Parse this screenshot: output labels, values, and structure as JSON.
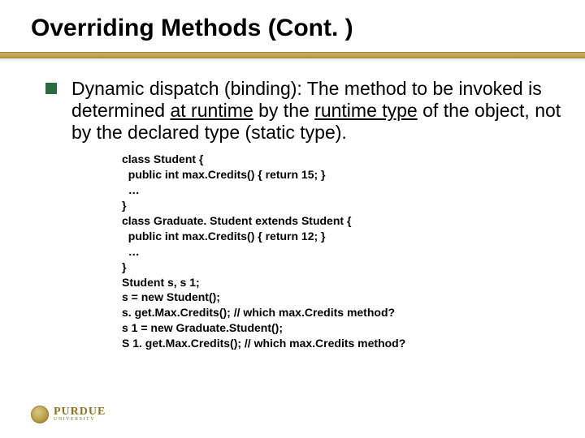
{
  "title": "Overriding Methods (Cont. )",
  "bullet": {
    "seg0": "Dynamic dispatch (binding): The method to be invoked is determined ",
    "seg1": "at runtime",
    "seg2": " by the ",
    "seg3": "runtime type",
    "seg4": " of the object, not by the declared type (static type)."
  },
  "code": "class Student {\n  public int max.Credits() { return 15; }\n  …\n}\nclass Graduate. Student extends Student {\n  public int max.Credits() { return 12; }\n  …\n}\nStudent s, s 1;\ns = new Student();\ns. get.Max.Credits(); // which max.Credits method?\ns 1 = new Graduate.Student();\nS 1. get.Max.Credits(); // which max.Credits method?",
  "logo": {
    "main": "PURDUE",
    "sub": "UNIVERSITY"
  }
}
